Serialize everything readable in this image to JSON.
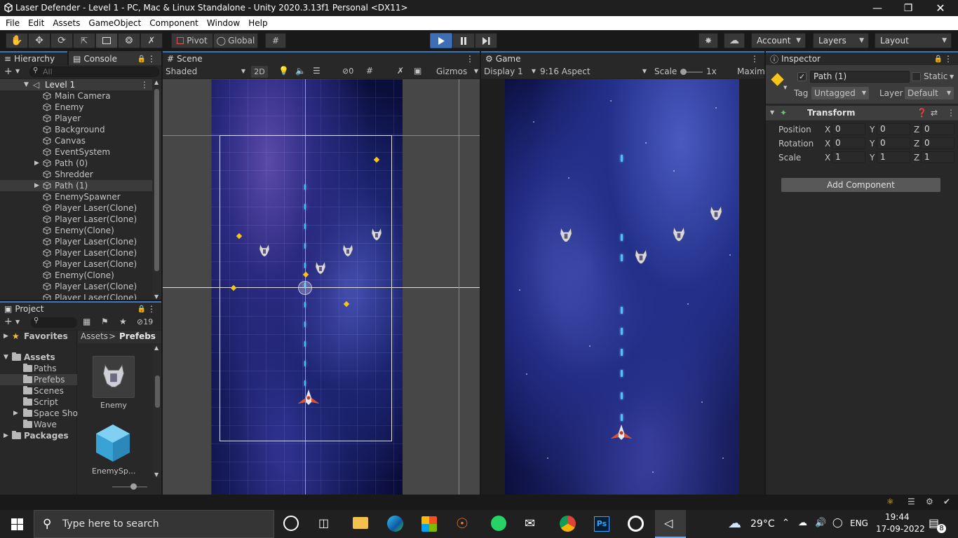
{
  "window": {
    "title": "Laser Defender - Level 1 - PC, Mac & Linux Standalone - Unity 2020.3.13f1 Personal <DX11>"
  },
  "menu": [
    "File",
    "Edit",
    "Assets",
    "GameObject",
    "Component",
    "Window",
    "Help"
  ],
  "toolbar": {
    "pivot": "Pivot",
    "global": "Global",
    "account": "Account",
    "layers": "Layers",
    "layout": "Layout"
  },
  "hierarchy": {
    "tabs": [
      "Hierarchy",
      "Console"
    ],
    "search_placeholder": "All",
    "scene": "Level 1",
    "items": [
      {
        "label": "Main Camera",
        "arrow": false,
        "selected": false
      },
      {
        "label": "Enemy",
        "arrow": false,
        "selected": false
      },
      {
        "label": "Player",
        "arrow": false,
        "selected": false
      },
      {
        "label": "Background",
        "arrow": false,
        "selected": false
      },
      {
        "label": "Canvas",
        "arrow": false,
        "selected": false
      },
      {
        "label": "EventSystem",
        "arrow": false,
        "selected": false
      },
      {
        "label": "Path (0)",
        "arrow": true,
        "selected": false
      },
      {
        "label": "Shredder",
        "arrow": false,
        "selected": false
      },
      {
        "label": "Path (1)",
        "arrow": true,
        "selected": true
      },
      {
        "label": "EnemySpawner",
        "arrow": false,
        "selected": false
      },
      {
        "label": "Player Laser(Clone)",
        "arrow": false,
        "selected": false
      },
      {
        "label": "Player Laser(Clone)",
        "arrow": false,
        "selected": false
      },
      {
        "label": "Enemy(Clone)",
        "arrow": false,
        "selected": false
      },
      {
        "label": "Player Laser(Clone)",
        "arrow": false,
        "selected": false
      },
      {
        "label": "Player Laser(Clone)",
        "arrow": false,
        "selected": false
      },
      {
        "label": "Player Laser(Clone)",
        "arrow": false,
        "selected": false
      },
      {
        "label": "Enemy(Clone)",
        "arrow": false,
        "selected": false
      },
      {
        "label": "Player Laser(Clone)",
        "arrow": false,
        "selected": false
      },
      {
        "label": "Player Laser(Clone)",
        "arrow": false,
        "selected": false
      }
    ]
  },
  "project": {
    "tab": "Project",
    "hidden_count": "19",
    "favorites": "Favorites",
    "assets": "Assets",
    "folders": [
      "Paths",
      "Prefebs",
      "Scenes",
      "Script",
      "Space Sho",
      "Wave"
    ],
    "packages": "Packages",
    "breadcrumb": [
      "Assets",
      "Prefebs"
    ],
    "tiles": [
      "Enemy",
      "EnemySp..."
    ]
  },
  "scene": {
    "tab": "Scene",
    "shading": "Shaded",
    "mode2d": "2D",
    "hidden": "0",
    "gizmos": "Gizmos"
  },
  "game": {
    "tab": "Game",
    "display": "Display 1",
    "aspect": "9:16 Aspect",
    "scale_label": "Scale",
    "scale_value": "1x",
    "maximize": "Maxim"
  },
  "inspector": {
    "tab": "Inspector",
    "object_name": "Path (1)",
    "static_label": "Static",
    "tag_label": "Tag",
    "tag_value": "Untagged",
    "layer_label": "Layer",
    "layer_value": "Default",
    "component": "Transform",
    "rows": [
      {
        "label": "Position",
        "x": "0",
        "y": "0",
        "z": "0"
      },
      {
        "label": "Rotation",
        "x": "0",
        "y": "0",
        "z": "0"
      },
      {
        "label": "Scale",
        "x": "1",
        "y": "1",
        "z": "1"
      }
    ],
    "axis": [
      "X",
      "Y",
      "Z"
    ],
    "add_component": "Add Component"
  },
  "taskbar": {
    "search_placeholder": "Type here to search",
    "weather": "29°C",
    "lang": "ENG",
    "time": "19:44",
    "date": "17-09-2022",
    "notif": "8"
  },
  "colors": {
    "accent": "#3a79bb",
    "play_active": "#3e6fb4",
    "bg": "#191919",
    "panel": "#282828"
  }
}
